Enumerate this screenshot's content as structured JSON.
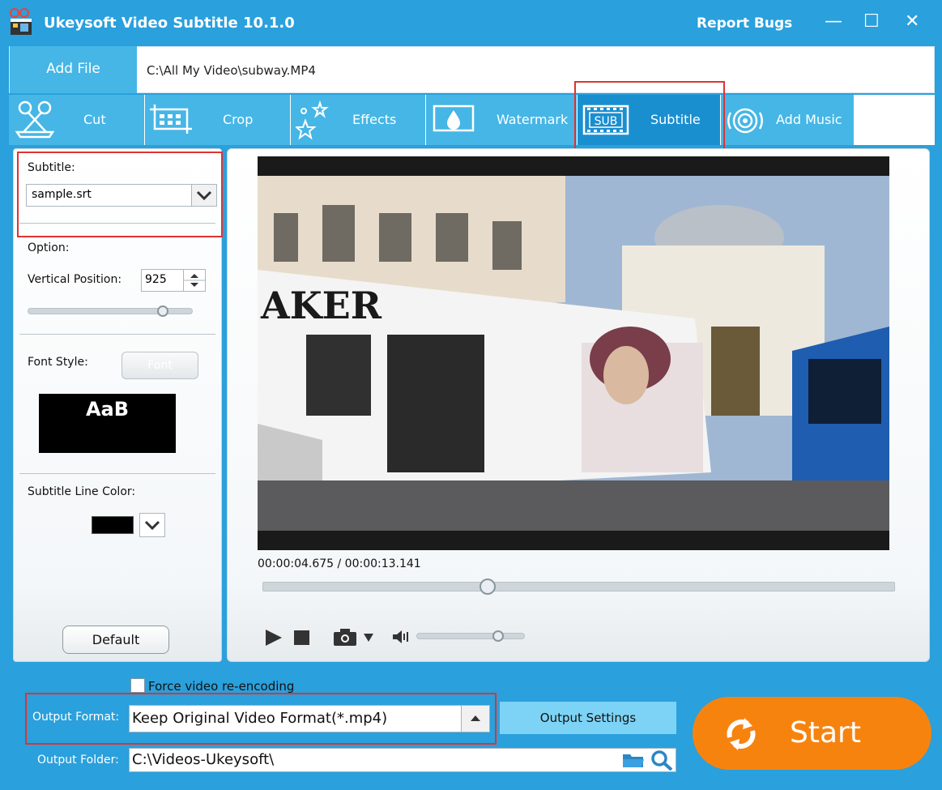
{
  "window": {
    "title": "Ukeysoft Video Subtitle 10.1.0",
    "report_bugs": "Report Bugs",
    "minimize": "—",
    "maximize": "☐",
    "close": "✕"
  },
  "file_bar": {
    "add_file": "Add File",
    "path": "C:\\All My Video\\subway.MP4"
  },
  "tabs": [
    {
      "label": "Cut",
      "icon": "scissors-icon"
    },
    {
      "label": "Crop",
      "icon": "crop-icon"
    },
    {
      "label": "Effects",
      "icon": "stars-icon"
    },
    {
      "label": "Watermark",
      "icon": "watermark-drop-icon"
    },
    {
      "label": "Subtitle",
      "icon": "subtitle-sub-icon",
      "active": true
    },
    {
      "label": "Add Music",
      "icon": "music-rings-icon"
    }
  ],
  "left_panel": {
    "subtitle_label": "Subtitle:",
    "subtitle_value": "sample.srt",
    "option_label": "Option:",
    "vertical_position_label": "Vertical Position:",
    "vertical_position_value": "925",
    "vertical_position_fraction": 0.82,
    "font_style_label": "Font Style:",
    "font_button": "Font",
    "font_preview": "AaB",
    "line_color_label": "Subtitle Line Color:",
    "line_color": "#000000",
    "default_button": "Default"
  },
  "player": {
    "time": "00:00:04.675 / 00:00:13.141",
    "progress_fraction": 0.356,
    "volume_fraction": 0.75,
    "video_text": "AKER"
  },
  "bottom": {
    "force_reencode": "Force video re-encoding",
    "output_format_label": "Output Format:",
    "output_format_value": "Keep Original Video Format(*.mp4)",
    "output_settings": "Output Settings",
    "output_folder_label": "Output Folder:",
    "output_folder_value": "C:\\Videos-Ukeysoft\\",
    "start": "Start"
  },
  "colors": {
    "accent": "#2aa0dc",
    "tab": "#45b6e6",
    "start": "#f7830f",
    "highlight_box": "#e03232"
  }
}
